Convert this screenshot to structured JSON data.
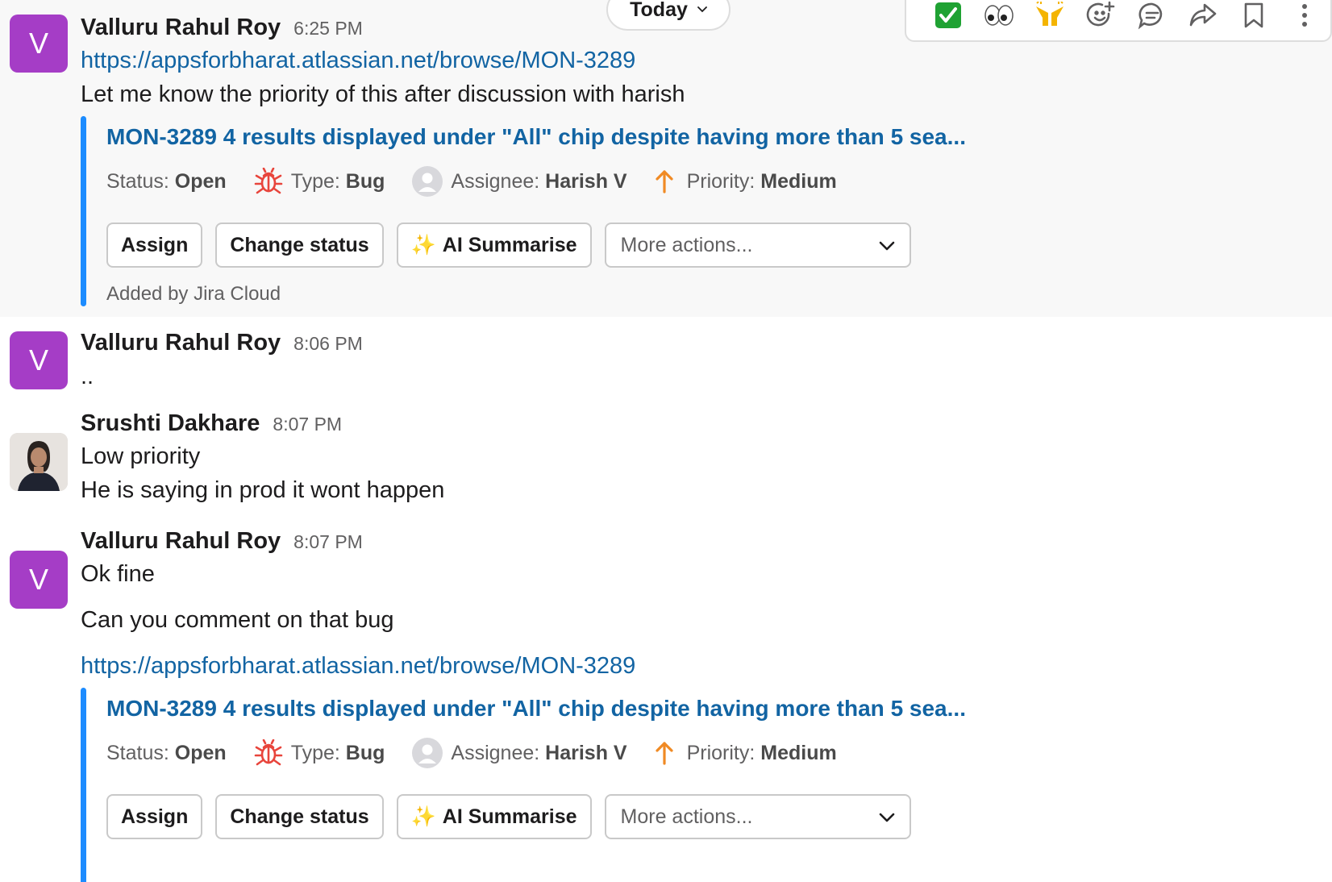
{
  "date_divider": {
    "label": "Today"
  },
  "hover_toolbar": {
    "icons": [
      "white-check-mark-icon",
      "eyes-icon",
      "raised-hands-icon",
      "add-reaction-icon",
      "reply-in-thread-icon",
      "forward-icon",
      "bookmark-icon",
      "more-icon"
    ]
  },
  "messages": [
    {
      "sender": "Valluru Rahul Roy",
      "time": "6:25 PM",
      "avatar_letter": "V",
      "lines": [
        "https://appsforbharat.atlassian.net/browse/MON-3289",
        "Let me know the priority of this after discussion with harish"
      ]
    },
    {
      "sender": "Valluru Rahul Roy",
      "time": "8:06 PM",
      "avatar_letter": "V",
      "lines": [
        ".."
      ]
    },
    {
      "sender": "Srushti Dakhare",
      "time": "8:07 PM",
      "lines": [
        "Low priority",
        "He is saying in prod it wont happen"
      ]
    },
    {
      "sender": "Valluru Rahul Roy",
      "time": "8:07 PM",
      "avatar_letter": "V",
      "lines": [
        "Ok fine",
        "Can you comment on that bug",
        "https://appsforbharat.atlassian.net/browse/MON-3289"
      ]
    }
  ],
  "jira_card": {
    "title": "MON-3289 4 results displayed under \"All\" chip despite having more than 5 sea...",
    "status_label": "Status:",
    "status_value": "Open",
    "type_label": "Type:",
    "type_value": "Bug",
    "assignee_label": "Assignee:",
    "assignee_value": "Harish V",
    "priority_label": "Priority:",
    "priority_value": "Medium",
    "assign_label": "Assign",
    "change_status_label": "Change status",
    "ai_summarise_label": "AI Summarise",
    "ai_summarise_emoji": "✨",
    "more_actions_label": "More actions...",
    "added_by": "Added by Jira Cloud"
  },
  "colors": {
    "link": "#1264a3",
    "avatar": "#a53dc6",
    "card_bar": "#1d8cff",
    "bug_icon": "#e8453c",
    "priority_icon": "#f08a24"
  }
}
